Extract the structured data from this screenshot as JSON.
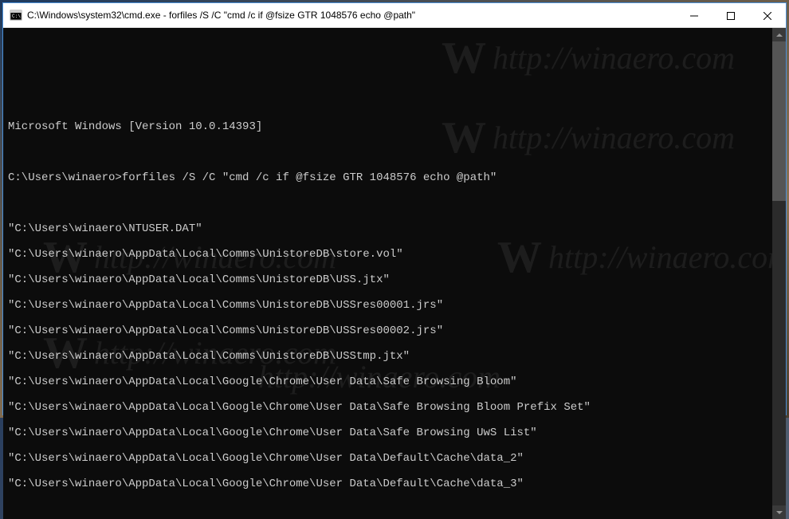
{
  "window": {
    "title": "C:\\Windows\\system32\\cmd.exe - forfiles  /S /C \"cmd /c if @fsize GTR 1048576 echo @path\""
  },
  "console": {
    "version_line": "Microsoft Windows [Version 10.0.14393]",
    "prompt": "C:\\Users\\winaero>",
    "command": "forfiles /S /C \"cmd /c if @fsize GTR 1048576 echo @path\"",
    "output_lines": [
      "\"C:\\Users\\winaero\\NTUSER.DAT\"",
      "\"C:\\Users\\winaero\\AppData\\Local\\Comms\\UnistoreDB\\store.vol\"",
      "\"C:\\Users\\winaero\\AppData\\Local\\Comms\\UnistoreDB\\USS.jtx\"",
      "\"C:\\Users\\winaero\\AppData\\Local\\Comms\\UnistoreDB\\USSres00001.jrs\"",
      "\"C:\\Users\\winaero\\AppData\\Local\\Comms\\UnistoreDB\\USSres00002.jrs\"",
      "\"C:\\Users\\winaero\\AppData\\Local\\Comms\\UnistoreDB\\USStmp.jtx\"",
      "\"C:\\Users\\winaero\\AppData\\Local\\Google\\Chrome\\User Data\\Safe Browsing Bloom\"",
      "\"C:\\Users\\winaero\\AppData\\Local\\Google\\Chrome\\User Data\\Safe Browsing Bloom Prefix Set\"",
      "\"C:\\Users\\winaero\\AppData\\Local\\Google\\Chrome\\User Data\\Safe Browsing UwS List\"",
      "\"C:\\Users\\winaero\\AppData\\Local\\Google\\Chrome\\User Data\\Default\\Cache\\data_2\"",
      "\"C:\\Users\\winaero\\AppData\\Local\\Google\\Chrome\\User Data\\Default\\Cache\\data_3\""
    ]
  },
  "watermark_text": "http://winaero.com"
}
